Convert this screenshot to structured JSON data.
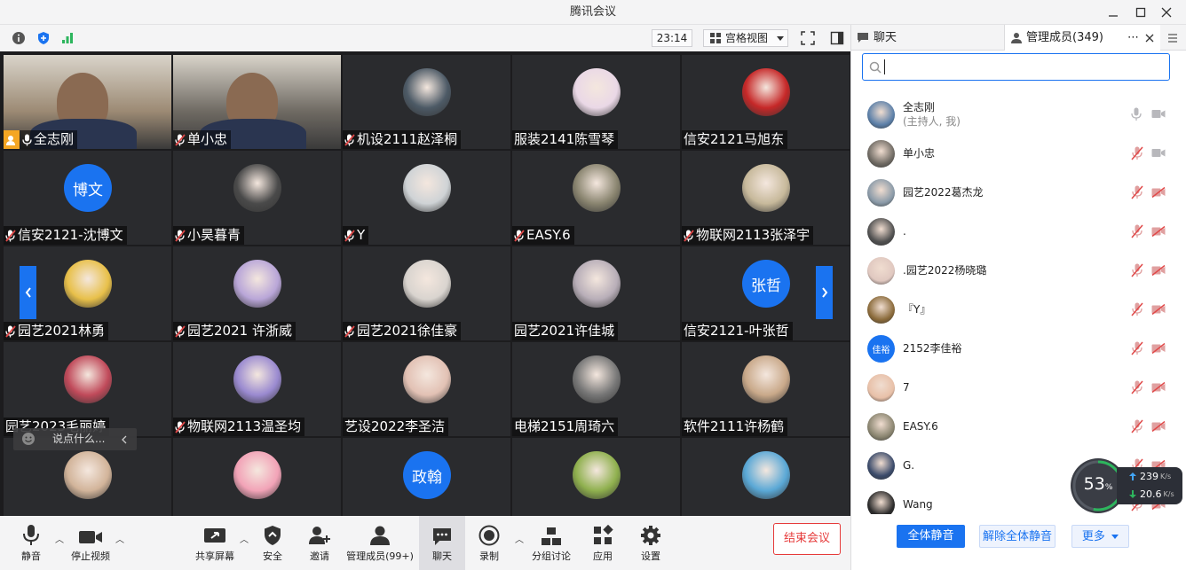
{
  "window": {
    "title": "腾讯会议"
  },
  "toolbar": {
    "clock": "23:14",
    "view_label": "宫格视图"
  },
  "tiles": [
    {
      "name": "全志刚",
      "type": "video",
      "mic": "on",
      "host": true,
      "bg": "#9c8a74"
    },
    {
      "name": "单小忠",
      "type": "video",
      "mic": "muted",
      "bg": "#6f6a63"
    },
    {
      "name": "机设2111赵泽桐",
      "type": "photo",
      "mic": "muted",
      "color": "#4d5a66"
    },
    {
      "name": "服装2141陈雪琴",
      "type": "photo",
      "mic": "none",
      "color": "#ead8e6"
    },
    {
      "name": "信安2121马旭东",
      "type": "photo",
      "mic": "none",
      "color": "#c62828"
    },
    {
      "name": "信安2121-沈博文",
      "type": "text",
      "avatar_text": "博文",
      "mic": "muted"
    },
    {
      "name": "小昊暮青",
      "type": "photo",
      "mic": "muted",
      "color": "#4a4a4a"
    },
    {
      "name": "Y",
      "type": "photo",
      "mic": "muted",
      "color": "#cfd3d6"
    },
    {
      "name": "EASY.6",
      "type": "photo",
      "mic": "muted",
      "color": "#8a8570"
    },
    {
      "name": "物联网2113张泽宇",
      "type": "photo",
      "mic": "muted",
      "color": "#c7b99b"
    },
    {
      "name": "园艺2021林勇",
      "type": "photo",
      "mic": "muted",
      "color": "#e8c04a"
    },
    {
      "name": "园艺2021 许浙威",
      "type": "photo",
      "mic": "muted",
      "color": "#b9a6d8"
    },
    {
      "name": "园艺2021徐佳豪",
      "type": "photo",
      "mic": "muted",
      "color": "#d9d4cf"
    },
    {
      "name": "园艺2021许佳城",
      "type": "photo",
      "mic": "none",
      "color": "#b8aeb8"
    },
    {
      "name": "信安2121-叶张哲",
      "type": "text",
      "avatar_text": "张哲",
      "mic": "none"
    },
    {
      "name": "园艺2023毛丽婷",
      "type": "photo",
      "mic": "none",
      "color": "#c04a5a"
    },
    {
      "name": "物联网2113温圣均",
      "type": "photo",
      "mic": "muted",
      "color": "#9a8ad0"
    },
    {
      "name": "艺设2022李圣洁",
      "type": "photo",
      "mic": "none",
      "color": "#e2c1b4"
    },
    {
      "name": "电梯2151周琦六",
      "type": "photo",
      "mic": "none",
      "color": "#777777"
    },
    {
      "name": "软件2111许杨鹤",
      "type": "photo",
      "mic": "none",
      "color": "#c9a98a"
    },
    {
      "type": "photo",
      "color": "#d2b49a"
    },
    {
      "type": "photo",
      "color": "#f2a3b7"
    },
    {
      "type": "text",
      "avatar_text": "政翰"
    },
    {
      "type": "photo",
      "color": "#8fb04e"
    },
    {
      "type": "photo",
      "color": "#5aa8d6"
    }
  ],
  "chat_input": {
    "placeholder": "说点什么..."
  },
  "bottombar": {
    "items": [
      {
        "label": "静音",
        "icon": "microphone-icon"
      },
      {
        "label": "停止视频",
        "icon": "video-camera-icon"
      },
      {
        "label": "共享屏幕",
        "icon": "share-screen-icon"
      },
      {
        "label": "安全",
        "icon": "shield-icon"
      },
      {
        "label": "邀请",
        "icon": "invite-icon"
      },
      {
        "label": "管理成员(99+)",
        "icon": "members-icon"
      },
      {
        "label": "聊天",
        "icon": "chat-icon"
      },
      {
        "label": "录制",
        "icon": "record-icon"
      },
      {
        "label": "分组讨论",
        "icon": "breakout-icon"
      },
      {
        "label": "应用",
        "icon": "apps-icon"
      },
      {
        "label": "设置",
        "icon": "gear-icon"
      }
    ],
    "end_label": "结束会议"
  },
  "right_panel": {
    "chat_tab": "聊天",
    "members_tab": "管理成员(349)",
    "members": [
      {
        "name": "全志刚",
        "role": "(主持人, 我)",
        "avatar_color": "#5b7fa8",
        "mic": "on"
      },
      {
        "name": "单小忠",
        "avatar_color": "#6f6a63",
        "mic": "muted"
      },
      {
        "name": "园艺2022葛杰龙",
        "avatar_color": "#8a9aa8",
        "mic": "muted"
      },
      {
        "name": ".",
        "avatar_color": "#505050",
        "mic": "muted"
      },
      {
        "name": ".园艺2022杨晓璐",
        "avatar_color": "#e0c8c0",
        "mic": "muted"
      },
      {
        "name": "『Y』",
        "avatar_color": "#8a6a3a",
        "mic": "muted"
      },
      {
        "name": "2152李佳裕",
        "avatar_text": "佳裕",
        "mic": "muted"
      },
      {
        "name": "7",
        "avatar_color": "#e8c0a8",
        "mic": "muted"
      },
      {
        "name": "EASY.6",
        "avatar_color": "#8a8570",
        "mic": "muted"
      },
      {
        "name": "G.",
        "avatar_color": "#3a4a6a",
        "mic": "muted"
      },
      {
        "name": "Wang",
        "avatar_color": "#2a2a2a",
        "mic": "muted"
      }
    ],
    "mute_all": "全体静音",
    "unmute_all": "解除全体静音",
    "more": "更多"
  },
  "network": {
    "percent": "53",
    "percent_unit": "%",
    "up": "239",
    "down": "20.6",
    "unit": "K/s"
  },
  "colors": {
    "accent": "#1a73f0",
    "end": "#e63a3a",
    "muted": "#e04848",
    "tile_bg": "#2a2b2e"
  }
}
